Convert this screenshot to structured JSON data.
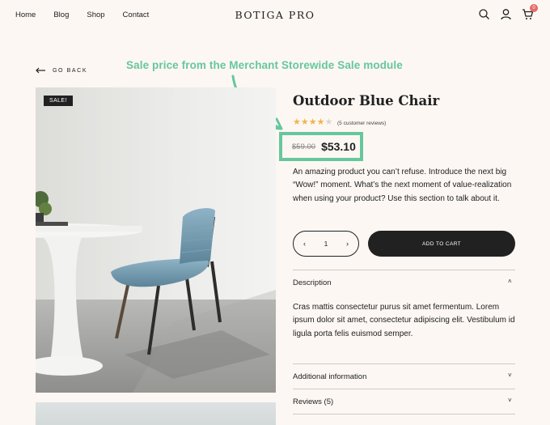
{
  "header": {
    "nav": [
      "Home",
      "Blog",
      "Shop",
      "Contact"
    ],
    "logo": "BOTIGA PRO",
    "cart_count": "0"
  },
  "annotation": {
    "text": "Sale price from the Merchant Storewide Sale module",
    "color": "#66c79c"
  },
  "go_back": "GO BACK",
  "product": {
    "badge": "SALE!",
    "title": "Outdoor Blue Chair",
    "rating": 4,
    "reviews_text": "(5 customer reviews)",
    "old_price": "$59.00",
    "price": "$53.10",
    "description": "An amazing product you can’t refuse. Introduce the next big “Wow!” moment. What’s the next moment of value-realization when using your product? Use this section to talk about it.",
    "quantity": "1",
    "add_to_cart": "ADD TO CART"
  },
  "accordion": {
    "description_title": "Description",
    "description_body": "Cras mattis consectetur purus sit amet fermentum. Lorem ipsum dolor sit amet, consectetur adipiscing elit. Vestibulum id ligula porta felis euismod semper.",
    "additional_title": "Additional information",
    "reviews_title": "Reviews (5)"
  },
  "colors": {
    "background": "#fcf7f3",
    "text": "#212121",
    "star": "#f0b44c",
    "accent": "#66c79c",
    "badge": "#e36b6b"
  }
}
